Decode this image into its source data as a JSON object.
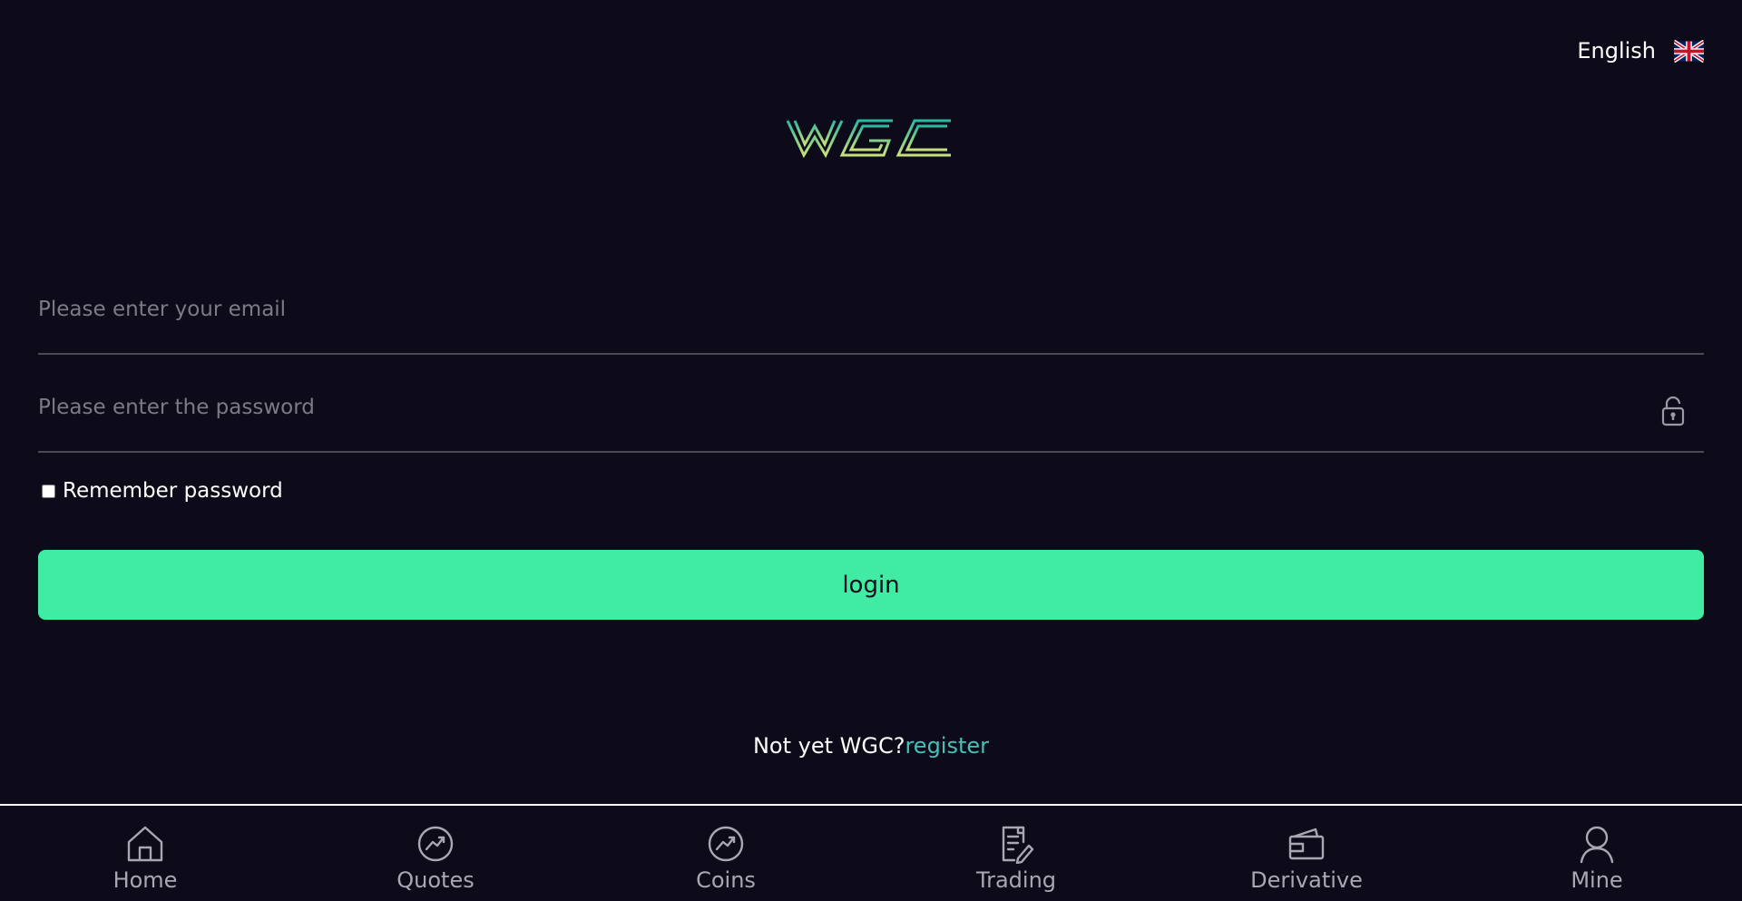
{
  "header": {
    "language_label": "English",
    "language_flag_icon": "uk-flag-icon"
  },
  "logo": {
    "text": "WGC",
    "icon": "wgc-logo",
    "colors": [
      "#2bb8a0",
      "#c6e07a"
    ]
  },
  "form": {
    "email_placeholder": "Please enter your email",
    "email_value": "",
    "password_placeholder": "Please enter the password",
    "password_value": "",
    "password_toggle_icon": "unlock-icon",
    "remember_label": "Remember password",
    "remember_checked": false,
    "login_label": "login"
  },
  "register": {
    "prefix": "Not yet WGC?",
    "link_label": "register"
  },
  "bottom_nav": {
    "items": [
      {
        "label": "Home",
        "icon": "home-icon"
      },
      {
        "label": "Quotes",
        "icon": "quotes-icon"
      },
      {
        "label": "Coins",
        "icon": "coins-icon"
      },
      {
        "label": "Trading",
        "icon": "trading-icon"
      },
      {
        "label": "Derivative",
        "icon": "wallet-icon"
      },
      {
        "label": "Mine",
        "icon": "user-icon"
      }
    ]
  },
  "colors": {
    "background": "#0d0b1a",
    "accent": "#40eca3",
    "link": "#45c2b8",
    "nav_text": "#a8a8b3"
  }
}
